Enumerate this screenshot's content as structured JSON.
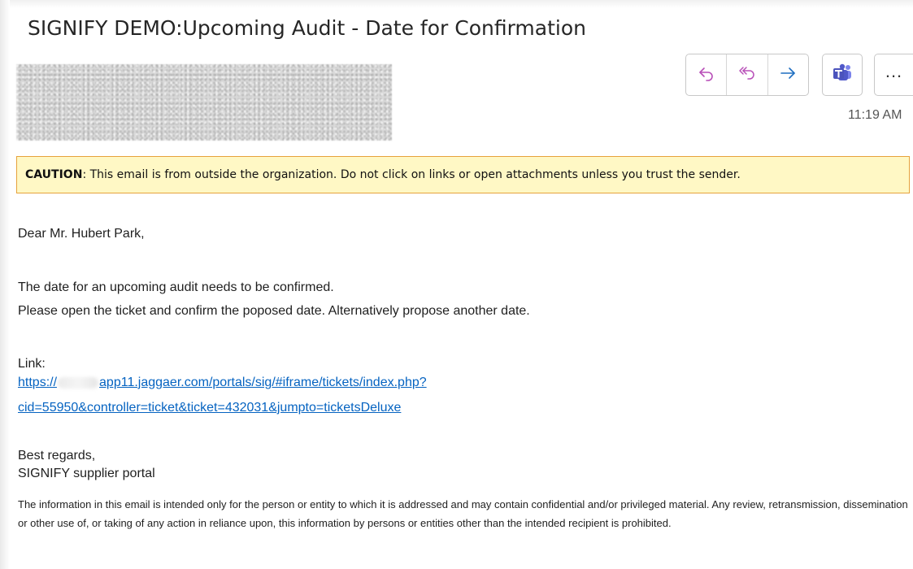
{
  "subject": "SIGNIFY DEMO:Upcoming Audit - Date for Confirmation",
  "toolbar": {
    "reply_icon": "reply-icon",
    "reply_all_icon": "reply-all-icon",
    "forward_icon": "forward-icon",
    "teams_icon": "teams-icon",
    "more_label": "...",
    "time": "11:19 AM"
  },
  "caution": {
    "label": "CAUTION",
    "text": ": This email is from outside the organization. Do not click on links or open attachments unless you trust the sender."
  },
  "body": {
    "greeting": "Dear Mr. Hubert Park,",
    "line1": "The date for an upcoming audit needs to be confirmed.",
    "line2": "Please open the ticket and confirm the poposed date. Alternatively propose another date.",
    "link_label": "Link:",
    "link_prefix": "https://",
    "link_line1_rest": "app11.jaggaer.com/portals/sig/#iframe/tickets/index.php?",
    "link_line2": "cid=55950&controller=ticket&ticket=432031&jumpto=ticketsDeluxe",
    "closing": "Best regards,",
    "signature": "SIGNIFY supplier portal",
    "disclaimer": "The information in this email is intended only for the person or entity to which it is addressed and may contain confidential and/or privileged material. Any review, retransmission, dissemination or other use of, or taking of any action in reliance upon, this information by persons or entities other than the intended recipient is prohibited."
  },
  "colors": {
    "accent_reply": "#b84fb8",
    "accent_forward": "#1f6fc1",
    "caution_bg": "#fff8c5",
    "caution_border": "#e6a23c",
    "link": "#0563c1"
  }
}
